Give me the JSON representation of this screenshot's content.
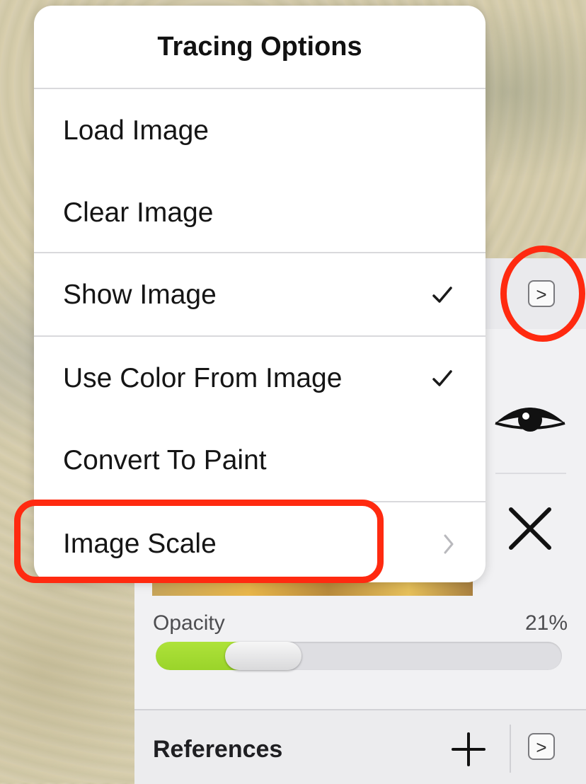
{
  "menu": {
    "title": "Tracing Options",
    "items": [
      {
        "label": "Load Image"
      },
      {
        "label": "Clear Image"
      },
      {
        "label": "Show Image",
        "checked": true
      },
      {
        "label": "Use Color From Image",
        "checked": true
      },
      {
        "label": "Convert To Paint"
      },
      {
        "label": "Image Scale",
        "has_submenu": true
      }
    ]
  },
  "side_panel": {
    "expand_arrow": ">",
    "icons": [
      "eye-icon",
      "close-icon"
    ],
    "opacity": {
      "label": "Opacity",
      "value_text": "21%",
      "value": 0.21
    }
  },
  "references": {
    "label": "References",
    "add_icon": "plus-icon",
    "arrow": ">"
  },
  "colors": {
    "highlight": "#ff2a10",
    "slider_fill": "#9ad42a"
  }
}
